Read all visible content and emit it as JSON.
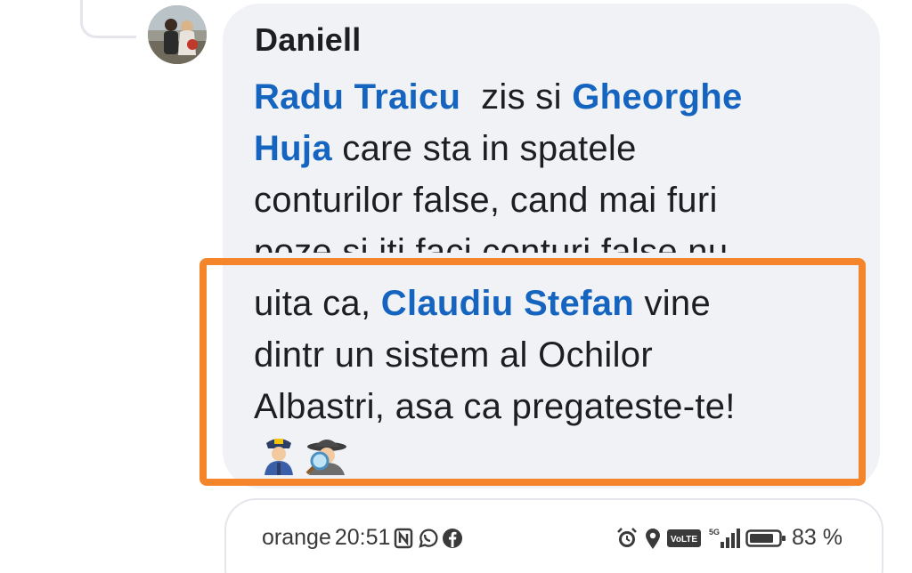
{
  "comment": {
    "author": "Daniell",
    "line1": {
      "mention_a": "Radu Traicu",
      "text_a": "  zis si ",
      "mention_b": "Gheorghe"
    },
    "line2": {
      "mention": "Huja",
      "text": " care sta in spatele"
    },
    "line3": "conturilor false, cand mai furi",
    "line4": "poze si iti faci conturi false nu",
    "line5": {
      "text_a": "uita ca, ",
      "mention": "Claudiu Stefan",
      "text_b": " vine"
    },
    "line6": "dintr un sistem al Ochilor",
    "line7": "Albastri, asa ca pregateste-te!",
    "emojis": [
      "police-officer-emoji",
      "detective-emoji"
    ]
  },
  "highlight": {
    "color": "#f5852b"
  },
  "status_bar": {
    "carrier": "orange",
    "time": "20:51",
    "battery": "83 %",
    "network": "5G",
    "volte": "VoLTE",
    "icons_left": [
      "nfc-icon",
      "whatsapp-icon",
      "facebook-icon"
    ],
    "icons_right": [
      "alarm-icon",
      "location-icon",
      "volte-icon",
      "signal-icon",
      "battery-icon"
    ]
  },
  "colors": {
    "mention": "#1565c0",
    "bubble": "#f0f2f5",
    "text": "#1c1e21"
  }
}
